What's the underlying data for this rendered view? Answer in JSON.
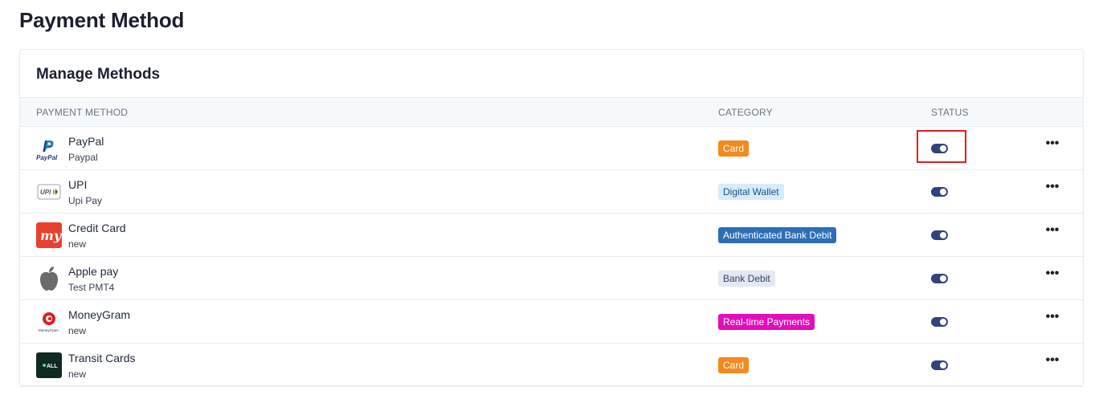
{
  "page": {
    "title": "Payment Method"
  },
  "card": {
    "title": "Manage Methods"
  },
  "table": {
    "headers": {
      "method": "PAYMENT METHOD",
      "category": "CATEGORY",
      "status": "STATUS"
    },
    "rows": [
      {
        "name": "PayPal",
        "subtitle": "Paypal",
        "icon": "paypal-logo-icon",
        "category": "Card",
        "category_bg": "#f5891f",
        "category_fg": "#ffffff",
        "enabled": true
      },
      {
        "name": "UPI",
        "subtitle": "Upi Pay",
        "icon": "upi-logo-icon",
        "category": "Digital Wallet",
        "category_bg": "#d6ebfb",
        "category_fg": "#1d4f8a",
        "enabled": true
      },
      {
        "name": "Credit Card",
        "subtitle": "new",
        "icon": "mmt-logo-icon",
        "category": "Authenticated Bank Debit",
        "category_bg": "#2d6eb5",
        "category_fg": "#ffffff",
        "enabled": true
      },
      {
        "name": "Apple pay",
        "subtitle": "Test PMT4",
        "icon": "apple-logo-icon",
        "category": "Bank Debit",
        "category_bg": "#e3e8f2",
        "category_fg": "#34406b",
        "enabled": true
      },
      {
        "name": "MoneyGram",
        "subtitle": "new",
        "icon": "moneygram-logo-icon",
        "category": "Real-time Payments",
        "category_bg": "#e20dbb",
        "category_fg": "#ffffff",
        "enabled": true
      },
      {
        "name": "Transit Cards",
        "subtitle": "new",
        "icon": "transit-card-logo-icon",
        "category": "Card",
        "category_bg": "#f5891f",
        "category_fg": "#ffffff",
        "enabled": true
      }
    ],
    "more_label": "•••"
  },
  "colors": {
    "toggle_on": "#33437a",
    "highlight": "#e01e1e"
  },
  "logo_text": {
    "paypal": "PayPal",
    "upi": "UPI",
    "mmt": "my",
    "moneygram": "MoneyGram",
    "transit": "ALL"
  }
}
